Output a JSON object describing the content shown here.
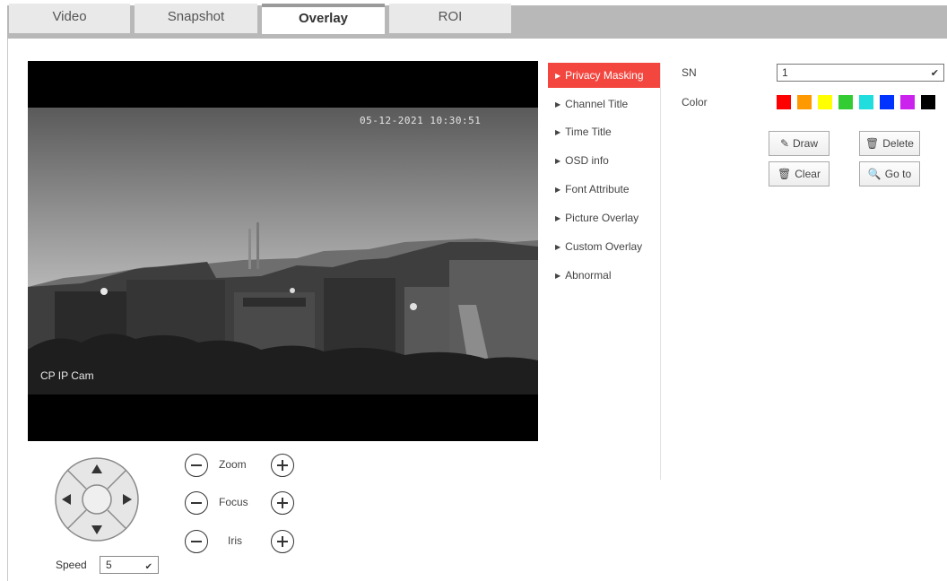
{
  "tabs": [
    {
      "label": "Video"
    },
    {
      "label": "Snapshot"
    },
    {
      "label": "Overlay"
    },
    {
      "label": "ROI"
    }
  ],
  "active_tab": "Overlay",
  "video": {
    "timestamp": "05-12-2021 10:30:51",
    "channel_title": "CP IP Cam"
  },
  "ptz": {
    "zoom_label": "Zoom",
    "focus_label": "Focus",
    "iris_label": "Iris",
    "speed_label": "Speed",
    "speed_value": "5"
  },
  "menu": [
    {
      "label": "Privacy Masking",
      "active": true
    },
    {
      "label": "Channel Title",
      "active": false
    },
    {
      "label": "Time Title",
      "active": false
    },
    {
      "label": "OSD info",
      "active": false
    },
    {
      "label": "Font Attribute",
      "active": false
    },
    {
      "label": "Picture Overlay",
      "active": false
    },
    {
      "label": "Custom Overlay",
      "active": false
    },
    {
      "label": "Abnormal",
      "active": false
    }
  ],
  "form": {
    "sn_label": "SN",
    "sn_value": "1",
    "color_label": "Color",
    "colors": [
      "#ff0000",
      "#ff9900",
      "#ffff00",
      "#33cc33",
      "#22dddd",
      "#0033ff",
      "#cc22ee",
      "#000000"
    ]
  },
  "buttons": {
    "draw": "Draw",
    "delete": "Delete",
    "clear": "Clear",
    "goto": "Go to"
  },
  "colors": {
    "accent": "#f2463f",
    "tabbar": "#b8b8b8"
  }
}
